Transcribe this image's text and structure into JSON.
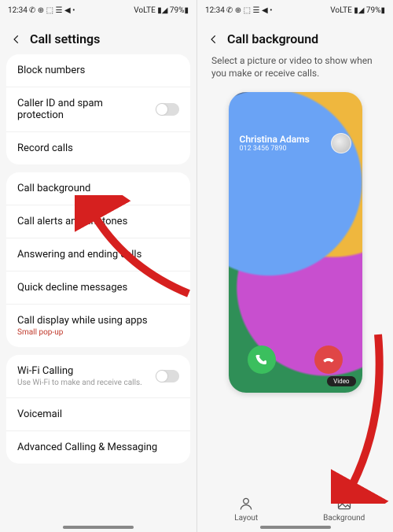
{
  "statusbar": {
    "time": "12:34",
    "icons_left": "✆ ⊕ ⬚ ☰ ◀ •",
    "icons_right": "VoLTE ▮◢ 79%▮"
  },
  "left": {
    "title": "Call settings",
    "group1": {
      "block_numbers": "Block numbers",
      "caller_id": "Caller ID and spam protection",
      "record_calls": "Record calls"
    },
    "group2": {
      "call_background": "Call background",
      "call_alerts": "Call alerts and ringtones",
      "answering": "Answering and ending calls",
      "quick_decline": "Quick decline messages",
      "call_display": "Call display while using apps",
      "call_display_sub": "Small pop-up"
    },
    "group3": {
      "wifi_calling": "Wi-Fi Calling",
      "wifi_calling_sub": "Use Wi-Fi to make and receive calls.",
      "voicemail": "Voicemail",
      "advanced": "Advanced Calling & Messaging"
    }
  },
  "right": {
    "title": "Call background",
    "subtitle": "Select a picture or video to show when you make or receive calls.",
    "caller_name": "Christina Adams",
    "caller_number": "012 3456 7890",
    "video_badge": "Video",
    "tab_layout": "Layout",
    "tab_background": "Background"
  }
}
